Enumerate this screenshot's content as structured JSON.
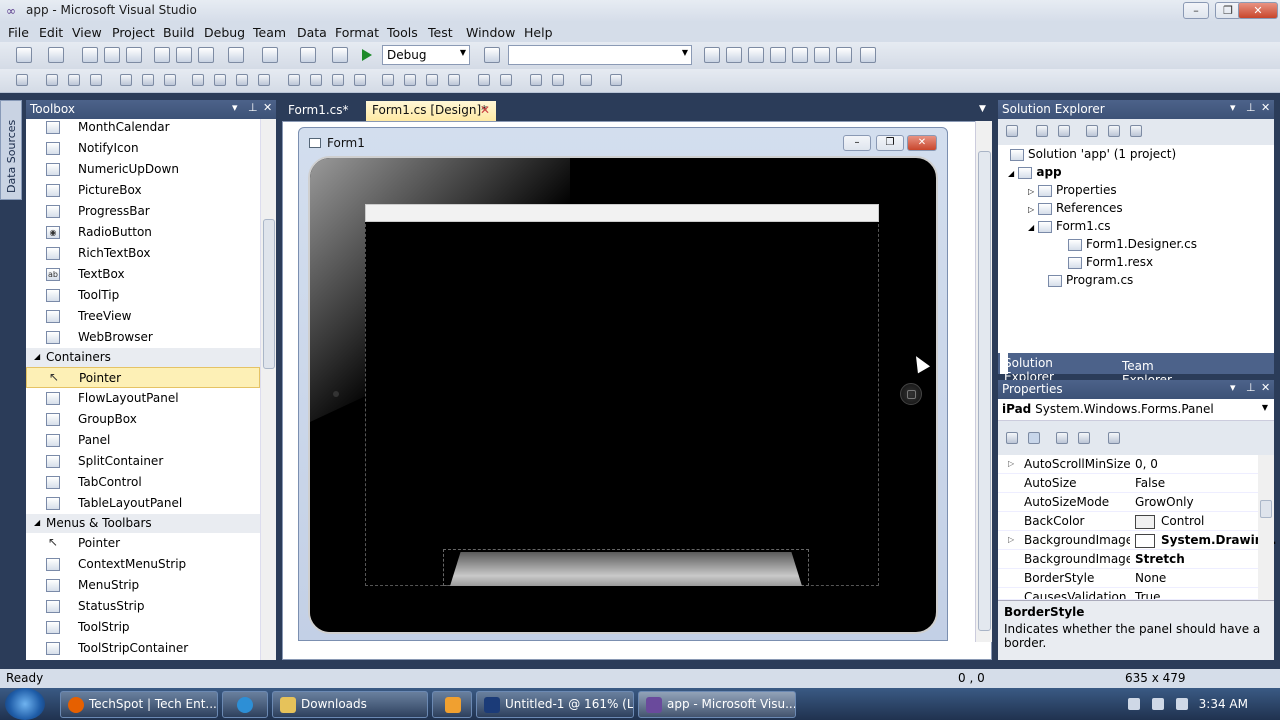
{
  "window": {
    "title": "app - Microsoft Visual Studio"
  },
  "menu": [
    "File",
    "Edit",
    "View",
    "Project",
    "Build",
    "Debug",
    "Team",
    "Data",
    "Format",
    "Tools",
    "Test",
    "Window",
    "Help"
  ],
  "toolbar": {
    "config": "Debug",
    "platform": ""
  },
  "side_tab": "Data Sources",
  "toolbox": {
    "title": "Toolbox",
    "items_top": [
      "MonthCalendar",
      "NotifyIcon",
      "NumericUpDown",
      "PictureBox",
      "ProgressBar",
      "RadioButton",
      "RichTextBox",
      "TextBox",
      "ToolTip",
      "TreeView",
      "WebBrowser"
    ],
    "cat_containers": "Containers",
    "items_containers": [
      "Pointer",
      "FlowLayoutPanel",
      "GroupBox",
      "Panel",
      "SplitContainer",
      "TabControl",
      "TableLayoutPanel"
    ],
    "cat_menus": "Menus & Toolbars",
    "items_menus": [
      "Pointer",
      "ContextMenuStrip",
      "MenuStrip",
      "StatusStrip",
      "ToolStrip",
      "ToolStripContainer"
    ]
  },
  "tabs": [
    "Form1.cs*",
    "Form1.cs [Design]*"
  ],
  "form": {
    "title": "Form1"
  },
  "solution": {
    "title": "Solution Explorer",
    "root": "Solution 'app' (1 project)",
    "project": "app",
    "nodes": [
      "Properties",
      "References",
      "Form1.cs",
      "Form1.Designer.cs",
      "Form1.resx",
      "Program.cs"
    ],
    "tab1": "Solution Explorer",
    "tab2": "Team Explorer"
  },
  "properties": {
    "title": "Properties",
    "object_name": "iPad",
    "object_type": "System.Windows.Forms.Panel",
    "rows": [
      {
        "name": "AutoScrollMinSize",
        "value": "0, 0"
      },
      {
        "name": "AutoSize",
        "value": "False"
      },
      {
        "name": "AutoSizeMode",
        "value": "GrowOnly"
      },
      {
        "name": "BackColor",
        "value": "Control"
      },
      {
        "name": "BackgroundImage",
        "value": "System.Drawing."
      },
      {
        "name": "BackgroundImageLa",
        "value": "Stretch"
      },
      {
        "name": "BorderStyle",
        "value": "None"
      },
      {
        "name": "CausesValidation",
        "value": "True"
      }
    ],
    "desc_title": "BorderStyle",
    "desc_text": "Indicates whether the panel should have a border."
  },
  "status": {
    "left": "Ready",
    "pos": "0 , 0",
    "size": "635 x 479"
  },
  "taskbar": {
    "items": [
      "TechSpot | Tech Ent...",
      "",
      "Downloads",
      "",
      "Untitled-1 @ 161% (L...",
      "app - Microsoft Visu..."
    ],
    "clock": "3:34 AM"
  }
}
